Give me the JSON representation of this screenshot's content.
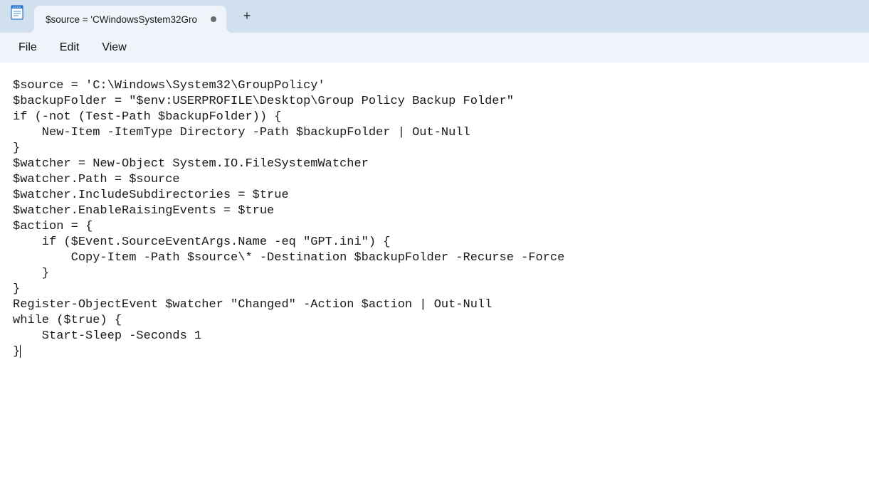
{
  "app": {
    "name": "Notepad"
  },
  "tabs": [
    {
      "title": "$source = 'CWindowsSystem32Gro",
      "dirty": true
    }
  ],
  "menu": {
    "file": "File",
    "edit": "Edit",
    "view": "View"
  },
  "new_tab_glyph": "+",
  "editor": {
    "content": "$source = 'C:\\Windows\\System32\\GroupPolicy'\n$backupFolder = \"$env:USERPROFILE\\Desktop\\Group Policy Backup Folder\"\nif (-not (Test-Path $backupFolder)) {\n    New-Item -ItemType Directory -Path $backupFolder | Out-Null\n}\n$watcher = New-Object System.IO.FileSystemWatcher\n$watcher.Path = $source\n$watcher.IncludeSubdirectories = $true\n$watcher.EnableRaisingEvents = $true\n$action = {\n    if ($Event.SourceEventArgs.Name -eq \"GPT.ini\") {\n        Copy-Item -Path $source\\* -Destination $backupFolder -Recurse -Force\n    }\n}\nRegister-ObjectEvent $watcher \"Changed\" -Action $action | Out-Null\nwhile ($true) {\n    Start-Sleep -Seconds 1\n}"
  },
  "colors": {
    "titlebar_bg": "#d1dfef",
    "chrome_bg": "#eff4fa",
    "text": "#1a1a1a"
  }
}
